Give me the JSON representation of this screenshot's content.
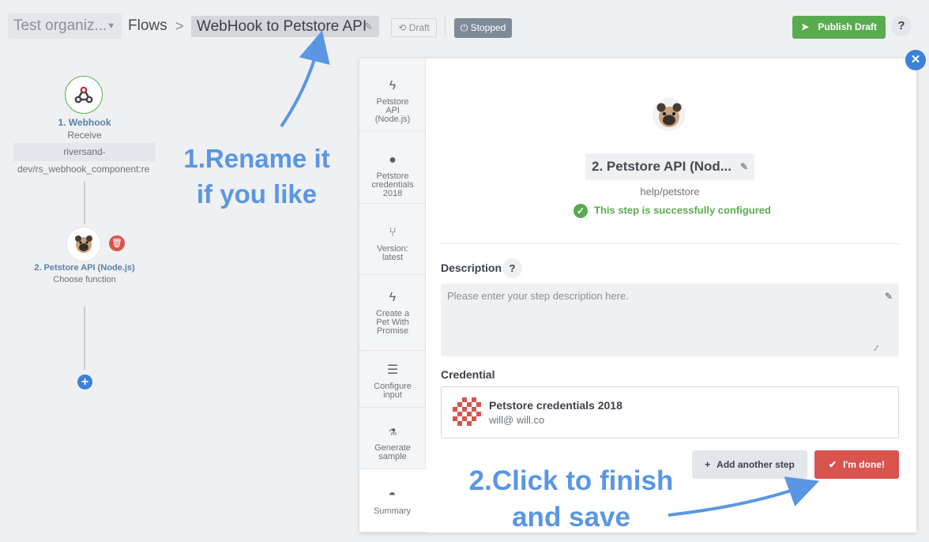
{
  "header": {
    "org_select": "Test organiz...",
    "breadcrumb_flows": "Flows",
    "breadcrumb_sep": ">",
    "flow_name": "WebHook to Petstore API",
    "draft_label": "Draft",
    "stopped_label": "Stopped",
    "publish_label": "Publish Draft",
    "help_label": "?"
  },
  "flow_graph": {
    "node1": {
      "title": "1. Webhook",
      "subtitle": "Receive",
      "path_line1": "riversand-",
      "path_line2": "dev/rs_webhook_component:re"
    },
    "node2": {
      "title": "2. Petstore API (Node.js)",
      "subtitle": "Choose function"
    },
    "add_label": "+"
  },
  "annotations": {
    "rename_line1": "1.Rename it",
    "rename_line2": "if you like",
    "finish_line1": "2.Click to finish",
    "finish_line2": "and save"
  },
  "tabs": [
    {
      "line1": "Petstore",
      "line2": "API",
      "line3": "(Node.js)",
      "icon": "bolt-icon"
    },
    {
      "line1": "Petstore",
      "line2": "credentials",
      "line3": "2018",
      "icon": "user-icon"
    },
    {
      "line1": "Version:",
      "line2": "latest",
      "icon": "branch-icon"
    },
    {
      "line1": "Create a",
      "line2": "Pet With",
      "line3": "Promise",
      "icon": "bolt-icon"
    },
    {
      "line1": "Configure",
      "line2": "input",
      "icon": "menu-icon"
    },
    {
      "line1": "Generate",
      "line2": "sample",
      "icon": "flask-icon"
    },
    {
      "line1": "Summary",
      "icon": "gauge-icon"
    }
  ],
  "step": {
    "title": "2. Petstore API (Nod...",
    "path": "help/petstore",
    "status": "This step is successfully configured"
  },
  "description": {
    "label": "Description",
    "help": "?",
    "placeholder": "Please enter your step description here."
  },
  "credential": {
    "label": "Credential",
    "name": "Petstore credentials 2018",
    "email": "will@ will.co"
  },
  "buttons": {
    "add_step": "Add another step",
    "done": "I'm done!"
  },
  "colors": {
    "publish_green": "#59ab4f",
    "done_red": "#d9534f",
    "annotation_blue": "#5a96e3",
    "stopped_gray": "#7f8a99"
  }
}
